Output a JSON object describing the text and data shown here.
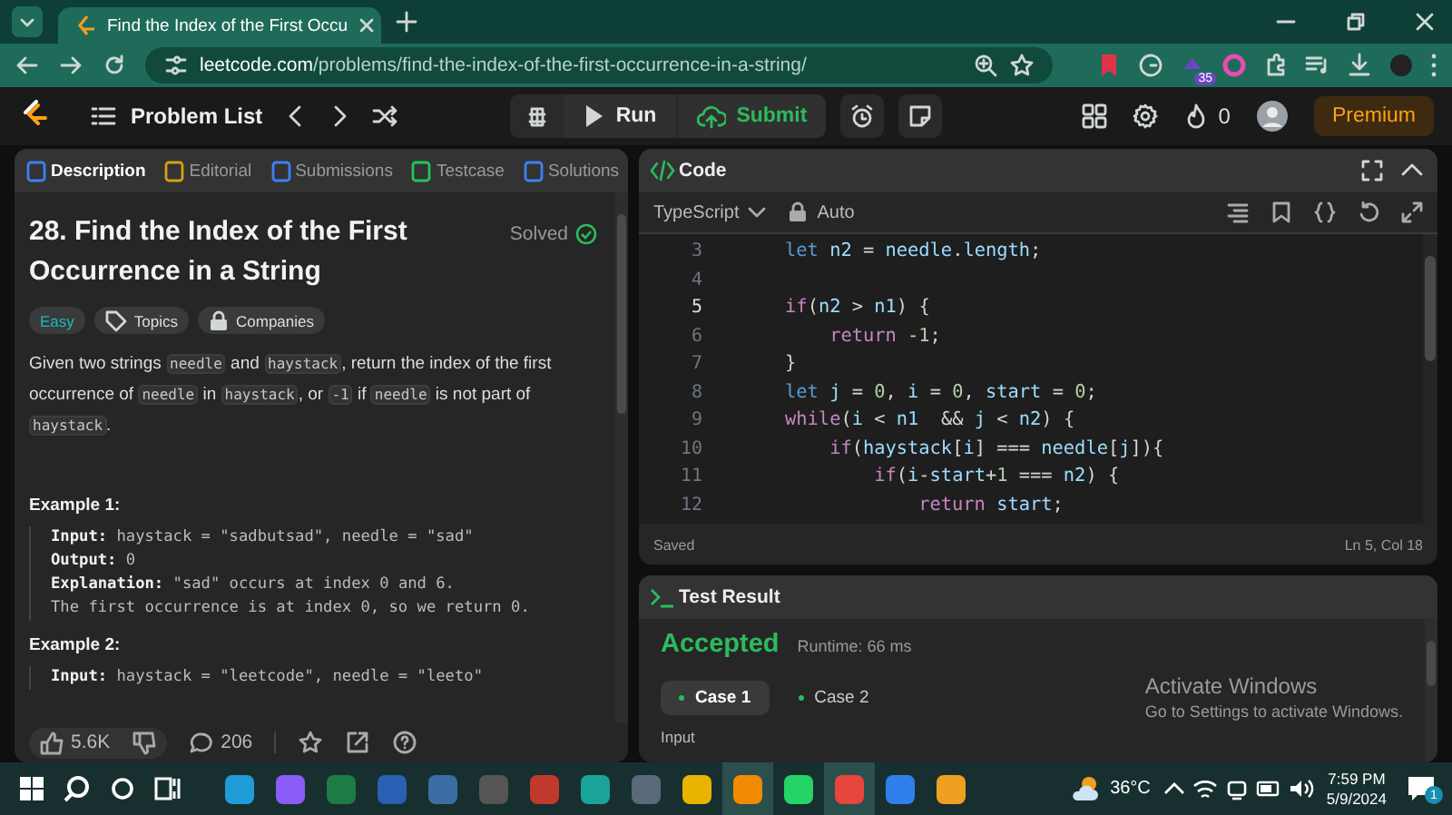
{
  "browser": {
    "tab_title": "Find the Index of the First Occu",
    "url_host": "leetcode.com",
    "url_path": "/problems/find-the-index-of-the-first-occurrence-in-a-string/",
    "extension_badge": "35"
  },
  "nav": {
    "problem_list": "Problem List",
    "run": "Run",
    "submit": "Submit",
    "streak": "0",
    "premium": "Premium"
  },
  "left_tabs": [
    {
      "label": "Description",
      "selected": true,
      "color": "#3b82f6"
    },
    {
      "label": "Editorial",
      "selected": false,
      "color": "#d4a017"
    },
    {
      "label": "Submissions",
      "selected": false,
      "color": "#3b82f6"
    },
    {
      "label": "Testcase",
      "selected": false,
      "color": "#22c55e"
    },
    {
      "label": "Solutions",
      "selected": false,
      "color": "#3b82f6"
    }
  ],
  "problem": {
    "title": "28. Find the Index of the First Occurrence in a String",
    "status": "Solved",
    "difficulty": "Easy",
    "topics": "Topics",
    "companies": "Companies",
    "description": [
      {
        "text": "Given two strings ",
        "code": false
      },
      {
        "text": "needle",
        "code": true
      },
      {
        "text": " and ",
        "code": false
      },
      {
        "text": "haystack",
        "code": true
      },
      {
        "text": ", return the index of the first occurrence of ",
        "code": false
      },
      {
        "text": "needle",
        "code": true
      },
      {
        "text": " in ",
        "code": false
      },
      {
        "text": "haystack",
        "code": true
      },
      {
        "text": ", or ",
        "code": false
      },
      {
        "text": "-1",
        "code": true
      },
      {
        "text": " if ",
        "code": false
      },
      {
        "text": "needle",
        "code": true
      },
      {
        "text": " is not part of ",
        "code": false
      },
      {
        "text": "haystack",
        "code": true
      },
      {
        "text": ".",
        "code": false
      }
    ],
    "examples": [
      {
        "title": "Example 1:",
        "lines": [
          "**Input:** haystack = \"sadbutsad\", needle = \"sad\"",
          "**Output:** 0",
          "**Explanation:** \"sad\" occurs at index 0 and 6.",
          "The first occurrence is at index 0, so we return 0."
        ]
      },
      {
        "title": "Example 2:",
        "lines": [
          "**Input:** haystack = \"leetcode\", needle = \"leeto\""
        ]
      }
    ]
  },
  "footer": {
    "likes": "5.6K",
    "comments": "206"
  },
  "code_panel": {
    "title": "Code",
    "language": "TypeScript",
    "mode": "Auto",
    "status": "Saved",
    "cursor": "Ln 5, Col 18",
    "lines": [
      {
        "num": "3",
        "current": false,
        "tokens": [
          {
            "text": "    let ",
            "kind": "decl"
          },
          {
            "text": "n2",
            "kind": "var"
          },
          {
            "text": " = ",
            "kind": "op"
          },
          {
            "text": "needle",
            "kind": "var"
          },
          {
            "text": ".",
            "kind": "op"
          },
          {
            "text": "length",
            "kind": "var"
          },
          {
            "text": ";",
            "kind": "op"
          }
        ]
      },
      {
        "num": "4",
        "current": false
      },
      {
        "num": "5",
        "current": true,
        "tokens": [
          {
            "text": "    if",
            "kind": "ctrl"
          },
          {
            "text": "(",
            "kind": "op"
          },
          {
            "text": "n2",
            "kind": "var"
          },
          {
            "text": " > ",
            "kind": "op"
          },
          {
            "text": "n1",
            "kind": "var"
          },
          {
            "text": ") {",
            "kind": "op"
          }
        ]
      },
      {
        "num": "6",
        "current": false,
        "tokens": [
          {
            "text": "        return",
            "kind": "ctrl"
          },
          {
            "text": " -",
            "kind": "op"
          },
          {
            "text": "1",
            "kind": "num"
          },
          {
            "text": ";",
            "kind": "op"
          }
        ]
      },
      {
        "num": "7",
        "current": false,
        "tokens": [
          {
            "text": "    }",
            "kind": "op"
          }
        ]
      },
      {
        "num": "8",
        "current": false,
        "tokens": [
          {
            "text": "    let ",
            "kind": "decl"
          },
          {
            "text": "j",
            "kind": "var"
          },
          {
            "text": " = ",
            "kind": "op"
          },
          {
            "text": "0",
            "kind": "num"
          },
          {
            "text": ", ",
            "kind": "op"
          },
          {
            "text": "i",
            "kind": "var"
          },
          {
            "text": " = ",
            "kind": "op"
          },
          {
            "text": "0",
            "kind": "num"
          },
          {
            "text": ", ",
            "kind": "op"
          },
          {
            "text": "start",
            "kind": "var"
          },
          {
            "text": " = ",
            "kind": "op"
          },
          {
            "text": "0",
            "kind": "num"
          },
          {
            "text": ";",
            "kind": "op"
          }
        ]
      },
      {
        "num": "9",
        "current": false,
        "tokens": [
          {
            "text": "    while",
            "kind": "ctrl"
          },
          {
            "text": "(",
            "kind": "op"
          },
          {
            "text": "i",
            "kind": "var"
          },
          {
            "text": " < ",
            "kind": "op"
          },
          {
            "text": "n1",
            "kind": "var"
          },
          {
            "text": "  && ",
            "kind": "op"
          },
          {
            "text": "j",
            "kind": "var"
          },
          {
            "text": " < ",
            "kind": "op"
          },
          {
            "text": "n2",
            "kind": "var"
          },
          {
            "text": ") {",
            "kind": "op"
          }
        ]
      },
      {
        "num": "10",
        "current": false,
        "tokens": [
          {
            "text": "        if",
            "kind": "ctrl"
          },
          {
            "text": "(",
            "kind": "op"
          },
          {
            "text": "haystack",
            "kind": "var"
          },
          {
            "text": "[",
            "kind": "op"
          },
          {
            "text": "i",
            "kind": "var"
          },
          {
            "text": "] === ",
            "kind": "op"
          },
          {
            "text": "needle",
            "kind": "var"
          },
          {
            "text": "[",
            "kind": "op"
          },
          {
            "text": "j",
            "kind": "var"
          },
          {
            "text": "]){",
            "kind": "op"
          }
        ]
      },
      {
        "num": "11",
        "current": false,
        "tokens": [
          {
            "text": "            if",
            "kind": "ctrl"
          },
          {
            "text": "(",
            "kind": "op"
          },
          {
            "text": "i",
            "kind": "var"
          },
          {
            "text": "-",
            "kind": "op"
          },
          {
            "text": "start",
            "kind": "var"
          },
          {
            "text": "+",
            "kind": "op"
          },
          {
            "text": "1",
            "kind": "num"
          },
          {
            "text": " === ",
            "kind": "op"
          },
          {
            "text": "n2",
            "kind": "var"
          },
          {
            "text": ") {",
            "kind": "op"
          }
        ]
      },
      {
        "num": "12",
        "current": false,
        "tokens": [
          {
            "text": "                return ",
            "kind": "ctrl"
          },
          {
            "text": "start",
            "kind": "var"
          },
          {
            "text": ";",
            "kind": "op"
          }
        ]
      }
    ]
  },
  "test_panel": {
    "title": "Test Result",
    "verdict": "Accepted",
    "runtime": "Runtime: 66 ms",
    "input_label": "Input",
    "cases": [
      {
        "label": "Case 1",
        "selected": true
      },
      {
        "label": "Case 2",
        "selected": false
      }
    ]
  },
  "activation": {
    "title": "Activate Windows",
    "subtitle": "Go to Settings to activate Windows."
  },
  "taskbar": {
    "apps": [
      {
        "color": "#1f9bd8",
        "active": false
      },
      {
        "color": "#8b5cf6",
        "active": false
      },
      {
        "color": "#1d7b45",
        "active": false
      },
      {
        "color": "#2b5fb4",
        "active": false
      },
      {
        "color": "#3a6ea5",
        "active": false
      },
      {
        "color": "#555555",
        "active": false
      },
      {
        "color": "#c0392b",
        "active": false
      },
      {
        "color": "#1aa39a",
        "active": false
      },
      {
        "color": "#5a6a7a",
        "active": false
      },
      {
        "color": "#e8b400",
        "active": false
      },
      {
        "color": "#f08a00",
        "active": true
      },
      {
        "color": "#25d366",
        "active": false
      },
      {
        "color": "#e8453c",
        "active": true
      },
      {
        "color": "#2f80ed",
        "active": false
      },
      {
        "color": "#f0a020",
        "active": false
      }
    ],
    "temperature": "36°C",
    "time": "7:59 PM",
    "date": "5/9/2024",
    "notification_count": "1"
  }
}
